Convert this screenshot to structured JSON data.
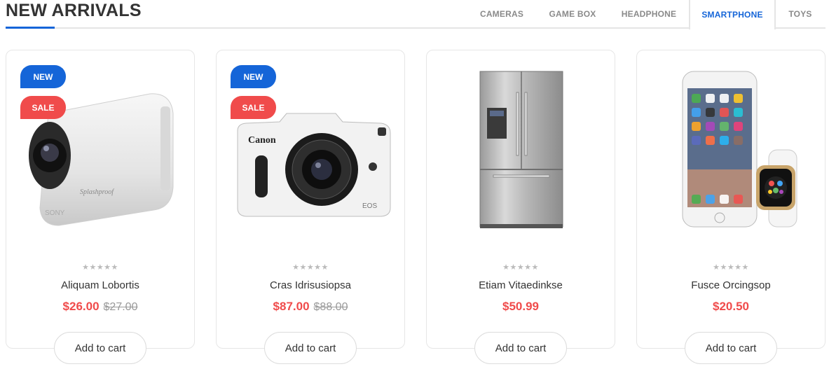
{
  "section": {
    "title": "NEW ARRIVALS"
  },
  "tabs": [
    {
      "label": "CAMERAS",
      "active": false
    },
    {
      "label": "GAME BOX",
      "active": false
    },
    {
      "label": "HEADPHONE",
      "active": false
    },
    {
      "label": "SMARTPHONE",
      "active": true
    },
    {
      "label": "TOYS",
      "active": false
    }
  ],
  "products": [
    {
      "name": "Aliquam Lobortis",
      "price": "$26.00",
      "old_price": "$27.00",
      "badges": [
        "NEW",
        "SALE"
      ],
      "rating": 0,
      "image": "action-camera-image",
      "cta": "Add to cart"
    },
    {
      "name": "Cras Idrisusiopsa",
      "price": "$87.00",
      "old_price": "$88.00",
      "badges": [
        "NEW",
        "SALE"
      ],
      "rating": 0,
      "image": "canon-camera-image",
      "cta": "Add to cart"
    },
    {
      "name": "Etiam Vitaedinkse",
      "price": "$50.99",
      "old_price": "",
      "badges": [],
      "rating": 0,
      "image": "refrigerator-image",
      "cta": "Add to cart"
    },
    {
      "name": "Fusce Orcingsop",
      "price": "$20.50",
      "old_price": "",
      "badges": [],
      "rating": 0,
      "image": "iphone-watch-image",
      "cta": "Add to cart"
    }
  ],
  "badge_labels": {
    "new": "NEW",
    "sale": "SALE"
  },
  "stars_glyph": "★★★★★",
  "colors": {
    "accent": "#1565d8",
    "sale": "#f04b4b",
    "price": "#f04b4b",
    "muted": "#999999"
  }
}
